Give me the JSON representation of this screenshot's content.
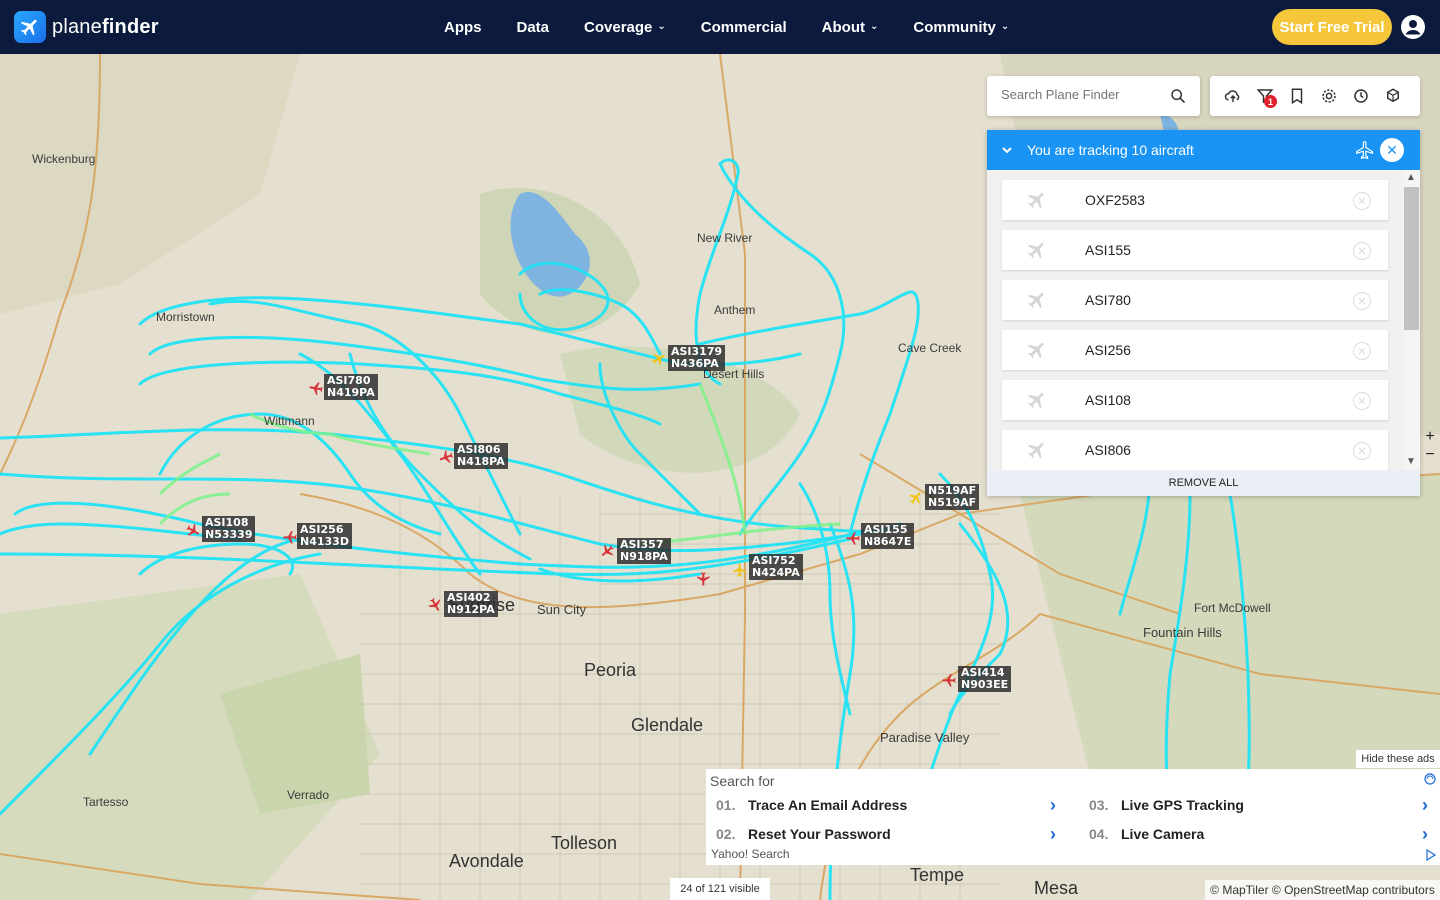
{
  "brand": {
    "name_light": "plane",
    "name_bold": "finder"
  },
  "nav": {
    "items": [
      {
        "label": "Apps",
        "dropdown": false
      },
      {
        "label": "Data",
        "dropdown": false
      },
      {
        "label": "Coverage",
        "dropdown": true
      },
      {
        "label": "Commercial",
        "dropdown": false
      },
      {
        "label": "About",
        "dropdown": true
      },
      {
        "label": "Community",
        "dropdown": true
      }
    ],
    "cta": "Start Free Trial"
  },
  "search": {
    "placeholder": "Search Plane Finder"
  },
  "toolbar": {
    "filter_badge": "1"
  },
  "tracking": {
    "title": "You are tracking 10 aircraft",
    "items": [
      "OXF2583",
      "ASI155",
      "ASI780",
      "ASI256",
      "ASI108",
      "ASI806"
    ],
    "remove_all": "REMOVE ALL"
  },
  "map": {
    "places": [
      {
        "name": "Wickenburg",
        "size": "normal"
      },
      {
        "name": "New River",
        "size": "normal"
      },
      {
        "name": "Anthem",
        "size": "normal"
      },
      {
        "name": "Morristown",
        "size": "normal"
      },
      {
        "name": "Cave Creek",
        "size": "normal"
      },
      {
        "name": "Desert Hills",
        "size": "normal"
      },
      {
        "name": "Wittmann",
        "size": "normal"
      },
      {
        "name": "Sun City",
        "size": "mid"
      },
      {
        "name": "Peoria",
        "size": "big"
      },
      {
        "name": "Glendale",
        "size": "big"
      },
      {
        "name": "Fort McDowell",
        "size": "normal"
      },
      {
        "name": "Fountain Hills",
        "size": "mid"
      },
      {
        "name": "Paradise Valley",
        "size": "mid"
      },
      {
        "name": "Tartesso",
        "size": "normal"
      },
      {
        "name": "Verrado",
        "size": "normal"
      },
      {
        "name": "Tolleson",
        "size": "big"
      },
      {
        "name": "Avondale",
        "size": "big"
      },
      {
        "name": "Tempe",
        "size": "big"
      },
      {
        "name": "Mesa",
        "size": "big"
      },
      {
        "name": "Surprise",
        "size": "big"
      }
    ],
    "aircraft": [
      {
        "callsign": "ASI3179",
        "reg": "N436PA",
        "color": "#f2c315"
      },
      {
        "callsign": "ASI780",
        "reg": "N419PA",
        "color": "#d6353a"
      },
      {
        "callsign": "ASI806",
        "reg": "N418PA",
        "color": "#d6353a"
      },
      {
        "callsign": "N519AF",
        "reg": "N519AF",
        "color": "#f2c315"
      },
      {
        "callsign": "ASI108",
        "reg": "N53339",
        "color": "#d6353a"
      },
      {
        "callsign": "ASI256",
        "reg": "N4133D",
        "color": "#d6353a"
      },
      {
        "callsign": "ASI155",
        "reg": "N8647E",
        "color": "#d6353a"
      },
      {
        "callsign": "ASI357",
        "reg": "N918PA",
        "color": "#d6353a"
      },
      {
        "callsign": "ASI752",
        "reg": "N424PA",
        "color": "#f2c315"
      },
      {
        "callsign": "ASI402",
        "reg": "N912PA",
        "color": "#d6353a"
      },
      {
        "callsign": "ASI414",
        "reg": "N903EE",
        "color": "#d6353a"
      }
    ],
    "visible_count": "24 of 121 visible",
    "attribution": "© MapTiler © OpenStreetMap contributors"
  },
  "ads": {
    "hide": "Hide these ads",
    "search_for": "Search for",
    "items": [
      {
        "num": "01.",
        "label": "Trace An Email Address"
      },
      {
        "num": "02.",
        "label": "Reset Your Password"
      },
      {
        "num": "03.",
        "label": "Live GPS Tracking"
      },
      {
        "num": "04.",
        "label": "Live Camera"
      }
    ],
    "provider": "Yahoo! Search"
  },
  "colors": {
    "nav_bg": "#0c1a3d",
    "accent": "#1994f5",
    "cta": "#f5c53a",
    "track": "#1fe3f5",
    "track_green": "#7cf28a"
  }
}
